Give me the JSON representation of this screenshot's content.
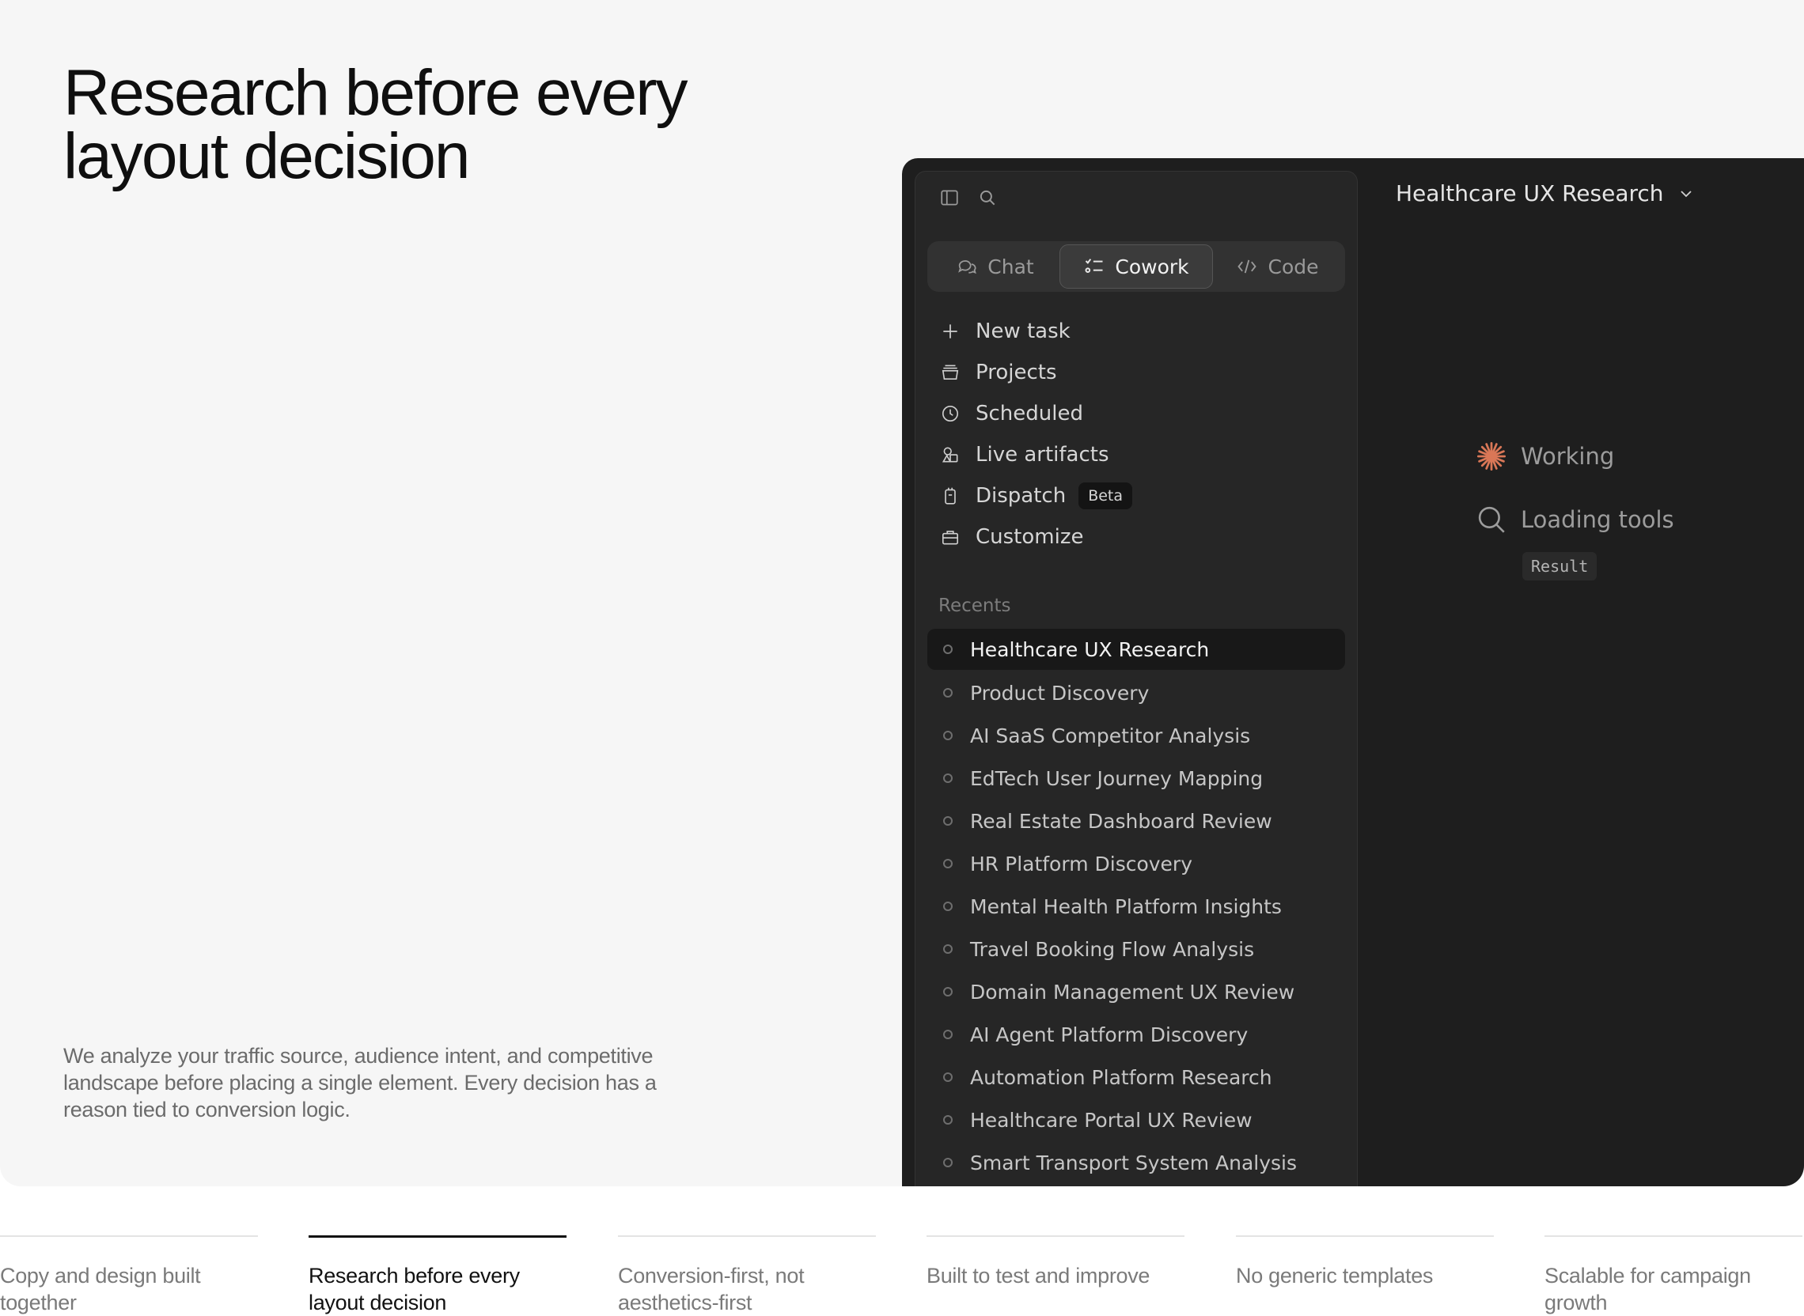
{
  "hero": {
    "headline": "Research before every layout decision",
    "description": "We analyze your traffic source, audience intent, and competitive landscape before placing a single element. Every decision has a reason tied to conversion logic."
  },
  "app": {
    "modes": [
      {
        "label": "Chat",
        "icon": "chat-bubbles-icon",
        "active": false
      },
      {
        "label": "Cowork",
        "icon": "task-list-icon",
        "active": true
      },
      {
        "label": "Code",
        "icon": "code-brackets-icon",
        "active": false
      }
    ],
    "nav": [
      {
        "label": "New task",
        "icon": "plus-icon"
      },
      {
        "label": "Projects",
        "icon": "folder-icon"
      },
      {
        "label": "Scheduled",
        "icon": "clock-icon"
      },
      {
        "label": "Live artifacts",
        "icon": "shapes-icon"
      },
      {
        "label": "Dispatch",
        "icon": "device-icon",
        "badge": "Beta"
      },
      {
        "label": "Customize",
        "icon": "briefcase-icon"
      }
    ],
    "recents_label": "Recents",
    "recents": [
      "Healthcare UX Research",
      "Product Discovery",
      "AI SaaS Competitor Analysis",
      "EdTech User Journey Mapping",
      "Real Estate Dashboard Review",
      "HR Platform Discovery",
      "Mental Health Platform Insights",
      "Travel Booking Flow Analysis",
      "Domain Management UX Review",
      "AI Agent Platform Discovery",
      "Automation Platform Research",
      "Healthcare Portal UX Review",
      "Smart Transport System Analysis"
    ],
    "conversation_title": "Healthcare UX Research",
    "status": {
      "working": "Working",
      "loading": "Loading tools",
      "result": "Result"
    },
    "colors": {
      "accent": "#d97757"
    }
  },
  "tabs": [
    {
      "label": "Copy and design built together",
      "active": false
    },
    {
      "label": "Research before every layout decision",
      "active": true
    },
    {
      "label": "Conversion-first, not aesthetics-first",
      "active": false
    },
    {
      "label": "Built to test and improve",
      "active": false
    },
    {
      "label": "No generic templates",
      "active": false
    },
    {
      "label": "Scalable for campaign growth",
      "active": false
    }
  ]
}
